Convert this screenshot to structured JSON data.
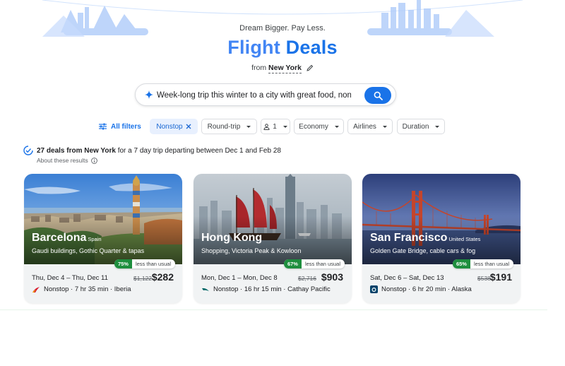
{
  "hero": {
    "tagline": "Dream Bigger. Pay Less.",
    "title_part1": "Flight",
    "title_part2": "Deals",
    "origin_prefix": "from",
    "origin_city": "New York"
  },
  "search": {
    "value": "Week-long trip this winter to a city with great food, non. ."
  },
  "filters": {
    "all_filters": "All filters",
    "chips": [
      {
        "label": "Nonstop"
      },
      {
        "label": "Round-trip"
      },
      {
        "label": "1"
      },
      {
        "label": "Economy"
      },
      {
        "label": "Airlines"
      },
      {
        "label": "Duration"
      }
    ]
  },
  "summary": {
    "count_text": "27 deals from New York",
    "rest_text": "for a 7 day trip departing between Dec 1 and Feb 28",
    "about": "About these results"
  },
  "deals": [
    {
      "city": "Barcelona",
      "country": "Spain",
      "subtitle": "Gaudi buildings, Gothic Quarter & tapas",
      "pct": "75%",
      "badge_label": "less than usual",
      "dates": "Thu, Dec 4 – Thu, Dec 11",
      "old_price": "$1,122",
      "price": "$282",
      "flight": "Nonstop · 7 hr 35 min · Iberia",
      "airline_icon": "iberia-logo-icon",
      "airline_color": "#d7192d"
    },
    {
      "city": "Hong Kong",
      "country": "",
      "subtitle": "Shopping, Victoria Peak & Kowloon",
      "pct": "67%",
      "badge_label": "less than usual",
      "dates": "Mon, Dec 1 – Mon, Dec 8",
      "old_price": "$2,716",
      "price": "$903",
      "flight": "Nonstop · 16 hr 15 min · Cathay Pacific",
      "airline_icon": "cathay-pacific-logo-icon",
      "airline_color": "#006564"
    },
    {
      "city": "San Francisco",
      "country": "United States",
      "subtitle": "Golden Gate Bridge, cable cars & fog",
      "pct": "65%",
      "badge_label": "less than usual",
      "dates": "Sat, Dec 6 – Sat, Dec 13",
      "old_price": "$538",
      "price": "$191",
      "flight": "Nonstop · 6 hr 20 min · Alaska",
      "airline_icon": "alaska-logo-icon",
      "airline_color": "#01426a"
    }
  ],
  "colors": {
    "accent": "#1a73e8",
    "badge_green": "#1e8e3e"
  }
}
